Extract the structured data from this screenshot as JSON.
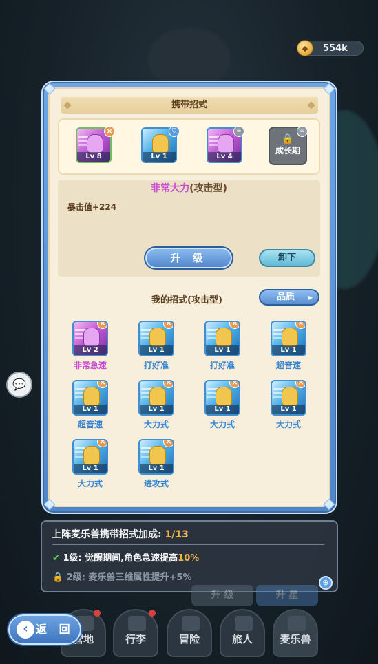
{
  "currency": {
    "amount": "554k"
  },
  "panel": {
    "title": "携带招式",
    "equipped": [
      {
        "level": "Lv 8",
        "badge": "×",
        "color": "purple"
      },
      {
        "level": "Lv 1",
        "badge": "shield",
        "color": "blue"
      },
      {
        "level": "Lv 4",
        "badge": "link",
        "color": "purple"
      }
    ],
    "locked_slot": {
      "label": "成长期"
    },
    "selected": {
      "name": "非常大力",
      "type": "(攻击型)",
      "stat": "暴击值+224"
    },
    "upgrade_label": "升 级",
    "unload_label": "卸下",
    "my_skills_title": "我的招式(攻击型)",
    "quality_label": "品质",
    "skills": [
      {
        "name": "非常急速",
        "level": "Lv 2",
        "color": "purple"
      },
      {
        "name": "打好准",
        "level": "Lv 1",
        "color": "blue"
      },
      {
        "name": "打好准",
        "level": "Lv 1",
        "color": "blue"
      },
      {
        "name": "超音速",
        "level": "Lv 1",
        "color": "blue"
      },
      {
        "name": "超音速",
        "level": "Lv 1",
        "color": "blue"
      },
      {
        "name": "大力式",
        "level": "Lv 1",
        "color": "blue"
      },
      {
        "name": "大力式",
        "level": "Lv 1",
        "color": "blue"
      },
      {
        "name": "大力式",
        "level": "Lv 1",
        "color": "blue"
      },
      {
        "name": "大力式",
        "level": "Lv 1",
        "color": "blue"
      },
      {
        "name": "进攻式",
        "level": "Lv 1",
        "color": "blue"
      }
    ]
  },
  "info": {
    "title": "上阵麦乐兽携带招式加成:",
    "count": "1/13",
    "row1_level": "1级:",
    "row1_text": "觉醒期间,角色急速提高",
    "row1_pct": "10%",
    "row2_level": "2级:",
    "row2_text": "麦乐兽三维属性提升+5%"
  },
  "background_buttons": {
    "upgrade": "升 级",
    "star": "升 星"
  },
  "nav": {
    "back": "返 回",
    "items": [
      "营地",
      "行李",
      "冒险",
      "旅人",
      "麦乐兽"
    ]
  }
}
